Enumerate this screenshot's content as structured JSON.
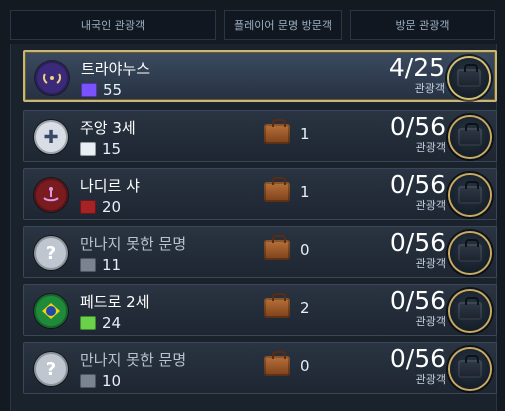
{
  "header": {
    "col1": "내국인 관광객",
    "col2": "플레이어 문명 방문객",
    "col3": "방문 관광객"
  },
  "rows": [
    {
      "name": "트라야누스",
      "tourism": "55",
      "visits": "",
      "ratio": "4/25",
      "ratio_label": "관광객",
      "civ_color": "#3b2a7a",
      "tourism_color": "#7b52ff",
      "selected": true,
      "civ_icon": "laurel-wreath-icon"
    },
    {
      "name": "주앙 3세",
      "tourism": "15",
      "visits": "1",
      "ratio": "0/56",
      "ratio_label": "관광객",
      "civ_color": "#d9dee6",
      "tourism_color": "#e9eef5",
      "civ_icon": "cross-icon"
    },
    {
      "name": "나디르 샤",
      "tourism": "20",
      "visits": "1",
      "ratio": "0/56",
      "ratio_label": "관광객",
      "civ_color": "#7a1b1f",
      "tourism_color": "#a52225",
      "civ_icon": "persia-emblem-icon"
    },
    {
      "name": "만나지 못한 문명",
      "tourism": "11",
      "visits": "0",
      "ratio": "0/56",
      "ratio_label": "관광객",
      "civ_color": "#bfc6d0",
      "tourism_color": "#7a8491",
      "unknown": true,
      "civ_icon": "question-mark-icon"
    },
    {
      "name": "페드로 2세",
      "tourism": "24",
      "visits": "2",
      "ratio": "0/56",
      "ratio_label": "관광객",
      "civ_color": "#1f8a3a",
      "tourism_color": "#69d24a",
      "civ_icon": "brazil-flag-icon"
    },
    {
      "name": "만나지 못한 문명",
      "tourism": "10",
      "visits": "0",
      "ratio": "0/56",
      "ratio_label": "관광객",
      "civ_color": "#bfc6d0",
      "tourism_color": "#7a8491",
      "unknown": true,
      "civ_icon": "question-mark-icon"
    }
  ]
}
